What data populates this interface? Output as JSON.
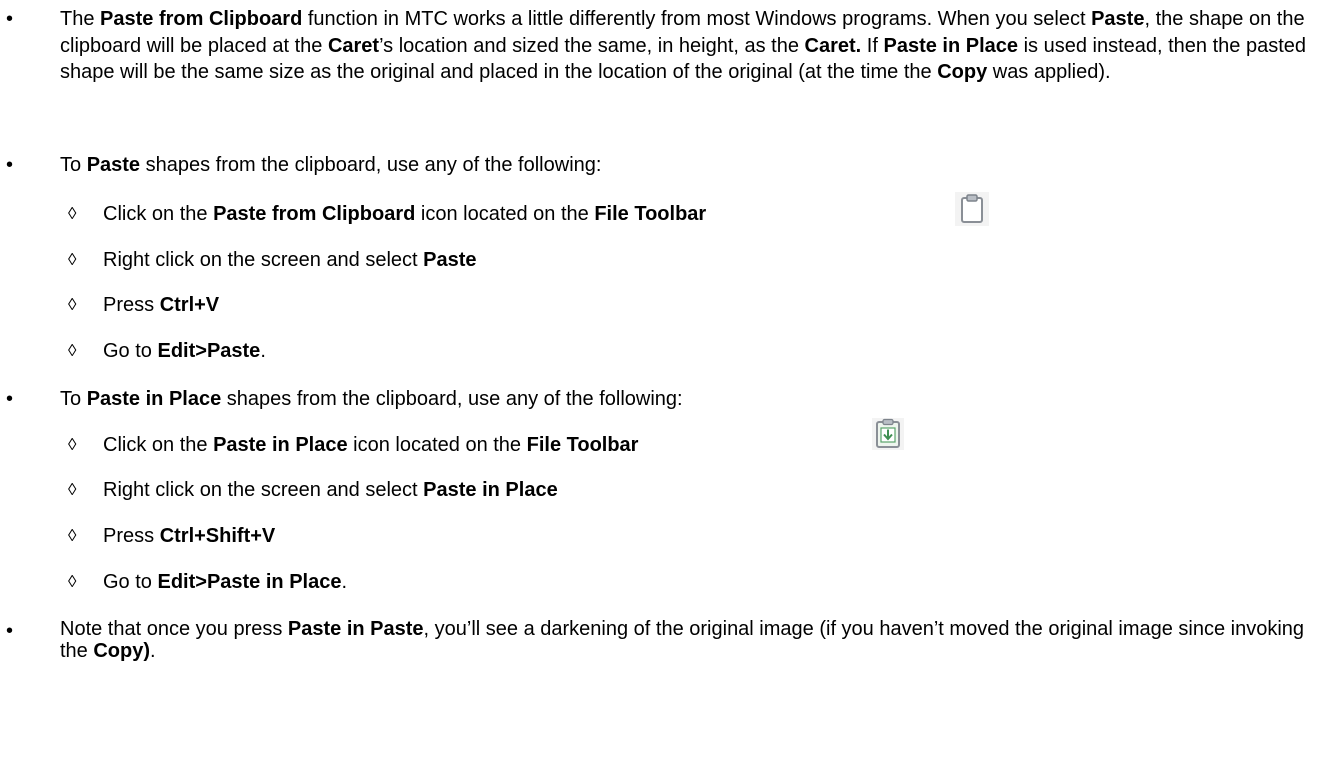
{
  "bullet_glyph": "•",
  "sub_glyph": "◊",
  "paragraph1": {
    "parts": [
      {
        "t": "The ",
        "b": false
      },
      {
        "t": "Paste from Clipboard",
        "b": true
      },
      {
        "t": " function in MTC works a little differently from most Windows programs. When you select ",
        "b": false
      },
      {
        "t": "Paste",
        "b": true
      },
      {
        "t": ", the shape on the clipboard will be placed at the ",
        "b": false
      },
      {
        "t": "Caret",
        "b": true
      },
      {
        "t": "’s location and sized the same, in height, as the ",
        "b": false
      },
      {
        "t": "Caret.",
        "b": true
      },
      {
        "t": "  If ",
        "b": false
      },
      {
        "t": "Paste in Place",
        "b": true
      },
      {
        "t": " is used instead, then the pasted shape will be the same size as the original and placed in the location of the original (at the time the ",
        "b": false
      },
      {
        "t": "Copy",
        "b": true
      },
      {
        "t": " was applied).",
        "b": false
      }
    ]
  },
  "paragraph2": {
    "parts": [
      {
        "t": " To ",
        "b": false
      },
      {
        "t": "Paste",
        "b": true
      },
      {
        "t": " shapes from the clipboard, use any of the following:",
        "b": false
      }
    ]
  },
  "paste_items": [
    {
      "parts": [
        {
          "t": "Click on the ",
          "b": false
        },
        {
          "t": "Paste from Clipboard",
          "b": true
        },
        {
          "t": " icon located on the ",
          "b": false
        },
        {
          "t": "File Toolbar",
          "b": true
        }
      ]
    },
    {
      "parts": [
        {
          "t": "Right click on the screen and select ",
          "b": false
        },
        {
          "t": "Paste",
          "b": true
        }
      ]
    },
    {
      "parts": [
        {
          "t": "Press ",
          "b": false
        },
        {
          "t": "Ctrl+V",
          "b": true
        }
      ]
    },
    {
      "parts": [
        {
          "t": "Go to ",
          "b": false
        },
        {
          "t": "Edit>Paste",
          "b": true
        },
        {
          "t": ".",
          "b": false
        }
      ]
    }
  ],
  "paragraph3": {
    "parts": [
      {
        "t": "To ",
        "b": false
      },
      {
        "t": "Paste in Place",
        "b": true
      },
      {
        "t": " shapes from the clipboard, use any of the following:",
        "b": false
      }
    ]
  },
  "place_items": [
    {
      "parts": [
        {
          "t": "Click on the ",
          "b": false
        },
        {
          "t": "Paste in Place",
          "b": true
        },
        {
          "t": " icon located on the ",
          "b": false
        },
        {
          "t": "File Toolbar",
          "b": true
        }
      ]
    },
    {
      "parts": [
        {
          "t": "Right click on the screen and select ",
          "b": false
        },
        {
          "t": "Paste in Place",
          "b": true
        }
      ]
    },
    {
      "parts": [
        {
          "t": "Press ",
          "b": false
        },
        {
          "t": "Ctrl+Shift+V",
          "b": true
        }
      ]
    },
    {
      "parts": [
        {
          "t": "Go to ",
          "b": false
        },
        {
          "t": "Edit>Paste in Place",
          "b": true
        },
        {
          "t": ".",
          "b": false
        }
      ]
    }
  ],
  "paragraph4": {
    "parts": [
      {
        "t": "Note that once you press ",
        "b": false
      },
      {
        "t": "Paste in Paste",
        "b": true
      },
      {
        "t": ", you’ll see a darkening of the original image (if you haven’t moved the original image since invoking the ",
        "b": false
      },
      {
        "t": "Copy)",
        "b": true
      },
      {
        "t": ".",
        "b": false
      }
    ]
  },
  "icons": {
    "clipboard": "clipboard-icon",
    "paste_in_place": "paste-in-place-icon"
  },
  "colors": {
    "text": "#000000",
    "icon_frame": "#8a8f96",
    "icon_green": "#5aa46a"
  }
}
